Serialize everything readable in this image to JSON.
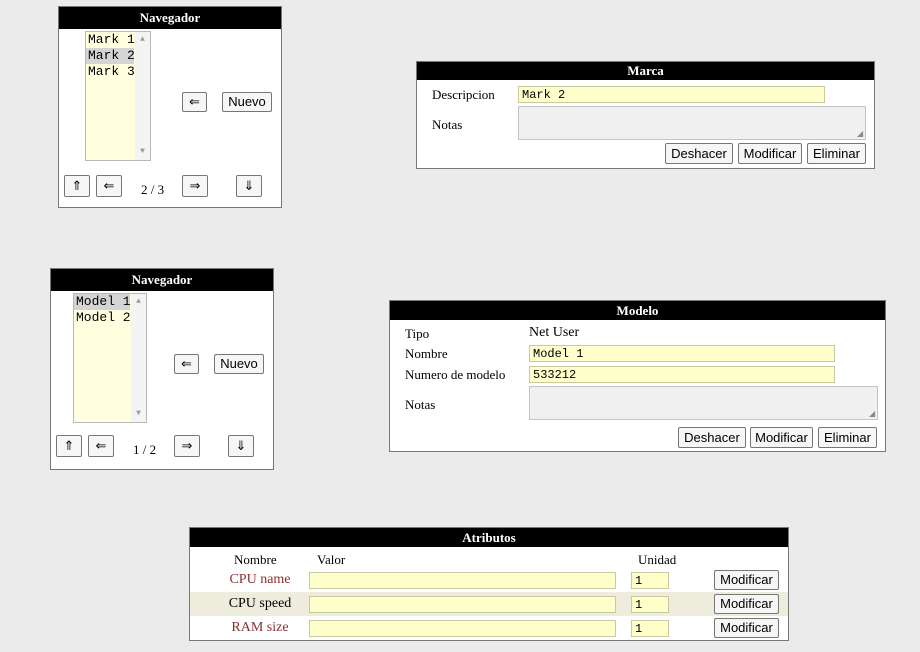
{
  "marca_nav": {
    "title": "Navegador",
    "items": [
      "Mark 1",
      "Mark 2",
      "Mark 3"
    ],
    "selected_index": 1,
    "pager": "2 / 3",
    "new_label": "Nuevo",
    "back_icon": "⇐",
    "first_icon": "⇑",
    "prev_icon": "⇐",
    "next_icon": "⇒",
    "last_icon": "⇓"
  },
  "marca": {
    "title": "Marca",
    "descripcion_label": "Descripcion",
    "descripcion_value": "Mark 2",
    "notas_label": "Notas",
    "notas_value": "",
    "undo_label": "Deshacer",
    "modify_label": "Modificar",
    "delete_label": "Eliminar"
  },
  "modelo_nav": {
    "title": "Navegador",
    "items": [
      "Model 1",
      "Model 2"
    ],
    "selected_index": 0,
    "pager": "1 / 2",
    "new_label": "Nuevo",
    "back_icon": "⇐",
    "first_icon": "⇑",
    "prev_icon": "⇐",
    "next_icon": "⇒",
    "last_icon": "⇓"
  },
  "modelo": {
    "title": "Modelo",
    "tipo_label": "Tipo",
    "tipo_value": "Net User",
    "nombre_label": "Nombre",
    "nombre_value": "Model 1",
    "numero_label": "Numero de modelo",
    "numero_value": "533212",
    "notas_label": "Notas",
    "notas_value": "",
    "undo_label": "Deshacer",
    "modify_label": "Modificar",
    "delete_label": "Eliminar"
  },
  "atributos": {
    "title": "Atributos",
    "col_nombre": "Nombre",
    "col_valor": "Valor",
    "col_unidad": "Unidad",
    "rows": [
      {
        "name": "CPU name",
        "valor": "",
        "unidad": "1",
        "action": "Modificar"
      },
      {
        "name": "CPU speed",
        "valor": "",
        "unidad": "1",
        "action": "Modificar"
      },
      {
        "name": "RAM size",
        "valor": "",
        "unidad": "1",
        "action": "Modificar"
      }
    ]
  },
  "colors": {
    "header_bg": "#000000",
    "field_bg": "#ffffcc",
    "attr_name_red": "#8b3030",
    "row_alt_bg": "#eeecdc"
  }
}
